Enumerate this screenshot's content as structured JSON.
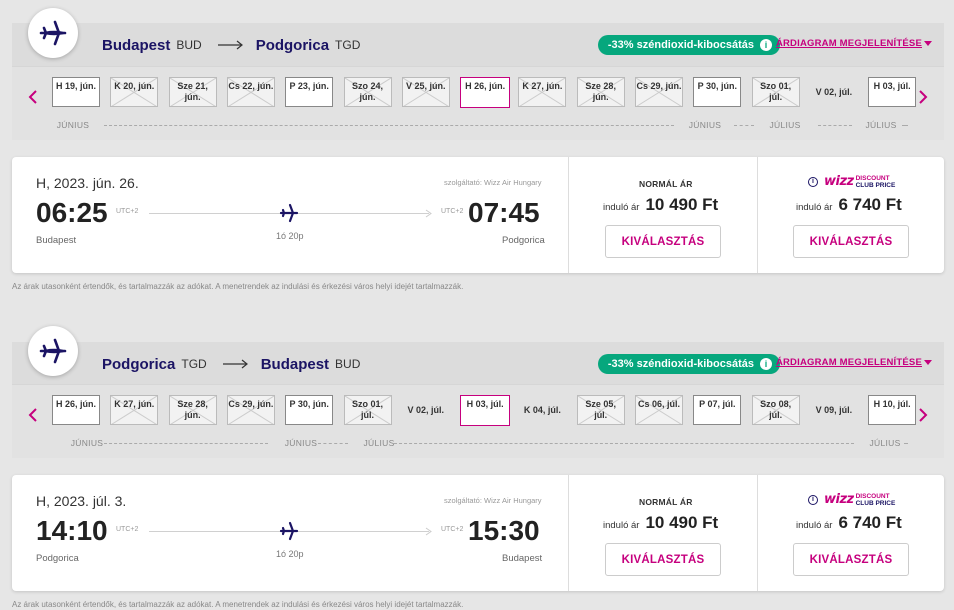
{
  "colors": {
    "brand_magenta": "#c6007e",
    "brand_navy": "#1b1464",
    "co2_green": "#06a77d"
  },
  "outbound": {
    "from_city": "Budapest",
    "from_code": "BUD",
    "to_city": "Podgorica",
    "to_code": "TGD",
    "co2_badge": "-33% széndioxid-kibocsátás",
    "price_chart_link": "ÁRDIAGRAM MEGJELENÍTÉSE",
    "dates": [
      {
        "label": "H 19, jún.",
        "state": "available"
      },
      {
        "label": "K 20, jún.",
        "state": "unavailable"
      },
      {
        "label": "Sze 21, jún.",
        "state": "unavailable"
      },
      {
        "label": "Cs 22, jún.",
        "state": "unavailable"
      },
      {
        "label": "P 23, jún.",
        "state": "available"
      },
      {
        "label": "Szo 24, jún.",
        "state": "unavailable"
      },
      {
        "label": "V 25, jún.",
        "state": "unavailable"
      },
      {
        "label": "H 26, jún.",
        "state": "selected"
      },
      {
        "label": "K 27, jún.",
        "state": "unavailable"
      },
      {
        "label": "Sze 28, jún.",
        "state": "unavailable"
      },
      {
        "label": "Cs 29, jún.",
        "state": "unavailable"
      },
      {
        "label": "P 30, jún.",
        "state": "available"
      },
      {
        "label": "Szo 01, júl.",
        "state": "unavailable"
      },
      {
        "label": "V 02, júl.",
        "state": "none"
      },
      {
        "label": "H 03, júl.",
        "state": "available"
      }
    ],
    "months": [
      "JÚNIUS",
      "JÚNIUS",
      "JÚLIUS",
      "JÚLIUS"
    ],
    "card": {
      "date": "H, 2023. jún. 26.",
      "operator": "szolgáltató: Wizz Air Hungary",
      "dep_time": "06:25",
      "dep_utc": "UTC+2",
      "dep_city": "Budapest",
      "arr_time": "07:45",
      "arr_utc": "UTC+2",
      "arr_city": "Podgorica",
      "duration": "1ó 20p",
      "normal_label": "NORMÁL ÁR",
      "from_label": "induló ár",
      "normal_price": "10 490 Ft",
      "discount_price": "6 740 Ft",
      "wdc_logo": "wizz",
      "wdc_line1": "DISCOUNT",
      "wdc_line2": "CLUB PRICE",
      "select_label": "KIVÁLASZTÁS"
    }
  },
  "return": {
    "from_city": "Podgorica",
    "from_code": "TGD",
    "to_city": "Budapest",
    "to_code": "BUD",
    "co2_badge": "-33% széndioxid-kibocsátás",
    "price_chart_link": "ÁRDIAGRAM MEGJELENÍTÉSE",
    "dates": [
      {
        "label": "H 26, jún.",
        "state": "available"
      },
      {
        "label": "K 27, jún.",
        "state": "unavailable"
      },
      {
        "label": "Sze 28, jún.",
        "state": "unavailable"
      },
      {
        "label": "Cs 29, jún.",
        "state": "unavailable"
      },
      {
        "label": "P 30, jún.",
        "state": "available"
      },
      {
        "label": "Szo 01, júl.",
        "state": "unavailable"
      },
      {
        "label": "V 02, júl.",
        "state": "none"
      },
      {
        "label": "H 03, júl.",
        "state": "selected"
      },
      {
        "label": "K 04, júl.",
        "state": "none"
      },
      {
        "label": "Sze 05, júl.",
        "state": "unavailable"
      },
      {
        "label": "Cs 06, júl.",
        "state": "unavailable"
      },
      {
        "label": "P 07, júl.",
        "state": "available"
      },
      {
        "label": "Szo 08, júl.",
        "state": "unavailable"
      },
      {
        "label": "V 09, júl.",
        "state": "none"
      },
      {
        "label": "H 10, júl.",
        "state": "available"
      }
    ],
    "months": [
      "JÚNIUS",
      "JÚNIUS",
      "JÚLIUS",
      "JÚLIUS"
    ],
    "card": {
      "date": "H, 2023. júl. 3.",
      "operator": "szolgáltató: Wizz Air Hungary",
      "dep_time": "14:10",
      "dep_utc": "UTC+2",
      "dep_city": "Podgorica",
      "arr_time": "15:30",
      "arr_utc": "UTC+2",
      "arr_city": "Budapest",
      "duration": "1ó 20p",
      "normal_label": "NORMÁL ÁR",
      "from_label": "induló ár",
      "normal_price": "10 490 Ft",
      "discount_price": "6 740 Ft",
      "wdc_logo": "wizz",
      "wdc_line1": "DISCOUNT",
      "wdc_line2": "CLUB PRICE",
      "select_label": "KIVÁLASZTÁS"
    }
  },
  "footnote": "Az árak utasonként értendők, és tartalmazzák az adókat. A menetrendek az indulási és érkezési város helyi idejét tartalmazzák."
}
